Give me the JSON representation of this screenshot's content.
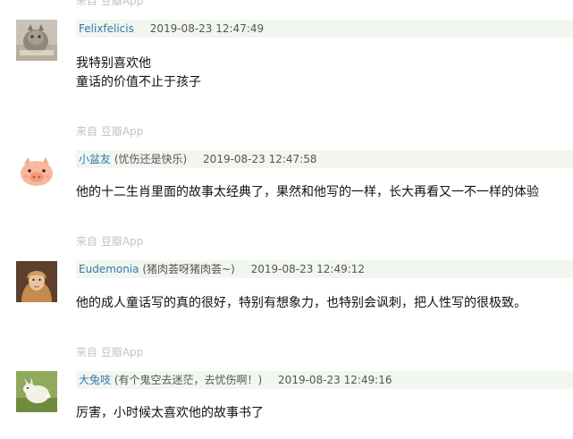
{
  "comments": [
    {
      "source_prev": "来自 豆瓣App",
      "author": "Felixfelicis",
      "status": "",
      "time": "2019-08-23 12:47:49",
      "content": [
        "我特别喜欢他",
        "童话的价值不止于孩子"
      ],
      "avatar_icon": "cat-photo-avatar"
    },
    {
      "source_prev": "来自 豆瓣App",
      "author": "小盆友",
      "status": "(忧伤还是快乐)",
      "time": "2019-08-23 12:47:58",
      "content": [
        "他的十二生肖里面的故事太经典了，果然和他写的一样，长大再看又一不一样的体验"
      ],
      "avatar_icon": "pig-avatar"
    },
    {
      "source_prev": "来自 豆瓣App",
      "author": "Eudemonia",
      "status": "(猪肉荟呀猪肉荟~)",
      "time": "2019-08-23 12:49:12",
      "content": [
        "他的成人童话写的真的很好，特别有想象力，也特别会讽刺，把人性写的很极致。"
      ],
      "avatar_icon": "portrait-avatar"
    },
    {
      "source_prev": "来自 豆瓣App",
      "author": "大兔吱",
      "status": "(有个鬼空去迷茫，去忧伤啊！)",
      "time": "2019-08-23 12:49:16",
      "content": [
        "厉害，小时候太喜欢他的故事书了"
      ],
      "avatar_icon": "rabbit-avatar"
    }
  ],
  "colors": {
    "author_link": "#3377aa",
    "meta_bar_bg": "#f1f7ef",
    "source_text": "#c4c4c4"
  }
}
